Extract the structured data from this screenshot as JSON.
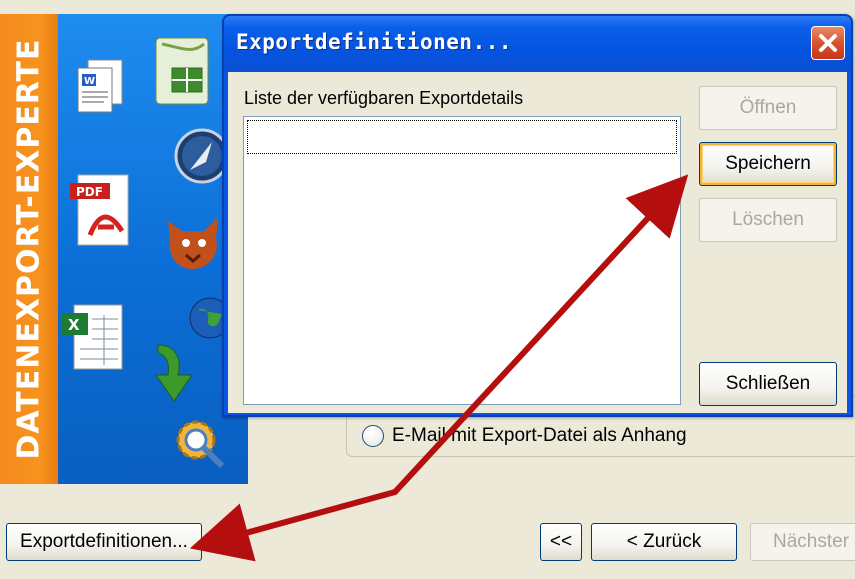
{
  "wizard": {
    "banner_text": "DATENEXPORT-EXPERTE",
    "email_option_label": "E-Mail mit Export-Datei als Anhang",
    "export_definitions_button": "Exportdefinitionen...",
    "first_button": "<<",
    "back_button": "< Zurück",
    "next_button": "Nächster"
  },
  "dialog": {
    "title": "Exportdefinitionen...",
    "list_label": "Liste der verfügbaren Exportdetails",
    "buttons": {
      "open": "Öffnen",
      "save": "Speichern",
      "delete": "Löschen",
      "close": "Schließen"
    }
  },
  "icons": [
    "word-document-icon",
    "spreadsheet-icon",
    "compass-icon",
    "pdf-icon",
    "firefox-icon",
    "globe-icon",
    "excel-icon",
    "green-arrow-icon",
    "gear-search-icon",
    "close-icon"
  ],
  "colors": {
    "titlebar": "#0a5fe8",
    "banner_orange": "#f7931e",
    "banner_blue": "#0b6ed6",
    "annotation_arrow": "#b40e0e",
    "close_button": "#d7522d"
  }
}
